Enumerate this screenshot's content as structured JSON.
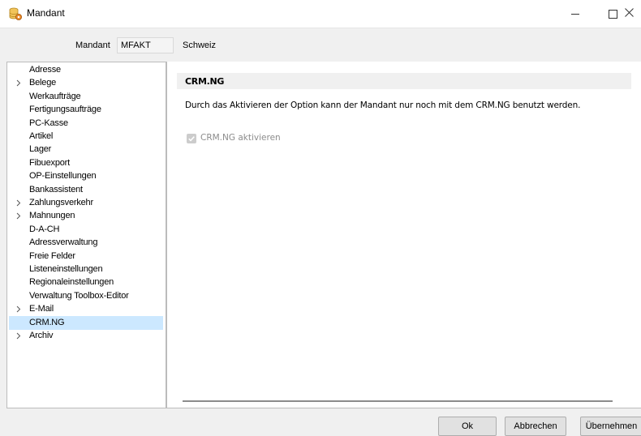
{
  "window": {
    "title": "Mandant",
    "minimize_icon": "minimize-icon",
    "maximize_icon": "maximize-icon",
    "close_icon": "close-icon"
  },
  "header": {
    "mandant_label": "Mandant",
    "mandant_code": "MFAKT",
    "mandant_name": "Schweiz"
  },
  "tree": {
    "items": [
      {
        "label": "Adresse",
        "expandable": false,
        "selected": false
      },
      {
        "label": "Belege",
        "expandable": true,
        "selected": false
      },
      {
        "label": "Werkaufträge",
        "expandable": false,
        "selected": false
      },
      {
        "label": "Fertigungsaufträge",
        "expandable": false,
        "selected": false
      },
      {
        "label": "PC-Kasse",
        "expandable": false,
        "selected": false
      },
      {
        "label": "Artikel",
        "expandable": false,
        "selected": false
      },
      {
        "label": "Lager",
        "expandable": false,
        "selected": false
      },
      {
        "label": "Fibuexport",
        "expandable": false,
        "selected": false
      },
      {
        "label": "OP-Einstellungen",
        "expandable": false,
        "selected": false
      },
      {
        "label": "Bankassistent",
        "expandable": false,
        "selected": false
      },
      {
        "label": "Zahlungsverkehr",
        "expandable": true,
        "selected": false
      },
      {
        "label": "Mahnungen",
        "expandable": true,
        "selected": false
      },
      {
        "label": "D-A-CH",
        "expandable": false,
        "selected": false
      },
      {
        "label": "Adressverwaltung",
        "expandable": false,
        "selected": false
      },
      {
        "label": "Freie Felder",
        "expandable": false,
        "selected": false
      },
      {
        "label": "Listeneinstellungen",
        "expandable": false,
        "selected": false
      },
      {
        "label": "Regionaleinstellungen",
        "expandable": false,
        "selected": false
      },
      {
        "label": "Verwaltung Toolbox-Editor",
        "expandable": false,
        "selected": false
      },
      {
        "label": "E-Mail",
        "expandable": true,
        "selected": false
      },
      {
        "label": "CRM.NG",
        "expandable": false,
        "selected": true
      },
      {
        "label": "Archiv",
        "expandable": true,
        "selected": false
      }
    ]
  },
  "content": {
    "section_title": "CRM.NG",
    "description": "Durch das Aktivieren der Option kann der Mandant nur noch mit dem CRM.NG benutzt werden.",
    "checkbox_label": "CRM.NG aktivieren",
    "checkbox_checked": true,
    "checkbox_enabled": false
  },
  "buttons": {
    "ok": "Ok",
    "cancel": "Abbrechen",
    "apply": "Übernehmen"
  },
  "colors": {
    "selection": "#cce8ff",
    "window_bg": "#f0f0f0",
    "disabled_text": "#8c8c8c"
  }
}
